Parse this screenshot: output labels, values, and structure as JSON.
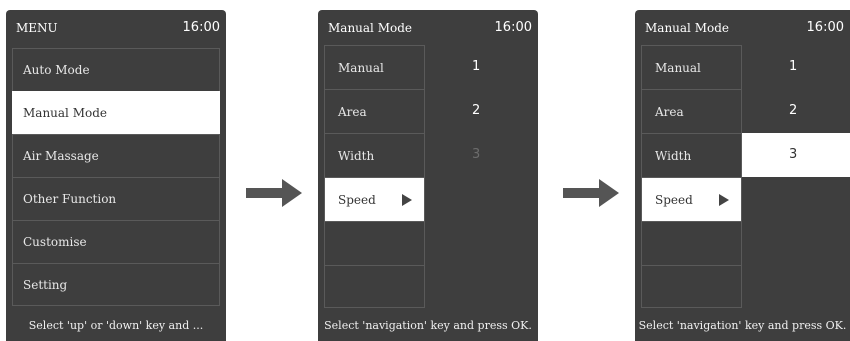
{
  "screen1": {
    "title": "MENU",
    "time": "16:00",
    "items": [
      {
        "label": "Auto Mode",
        "selected": false
      },
      {
        "label": "Manual Mode",
        "selected": true
      },
      {
        "label": "Air Massage",
        "selected": false
      },
      {
        "label": "Other Function",
        "selected": false
      },
      {
        "label": "Customise",
        "selected": false
      },
      {
        "label": "Setting",
        "selected": false
      }
    ],
    "footer": "Select 'up' or 'down' key and ..."
  },
  "screen2": {
    "title": "Manual Mode",
    "time": "16:00",
    "labels": [
      "Manual",
      "Area",
      "Width",
      "Speed"
    ],
    "values": [
      "1",
      "2",
      "3"
    ],
    "selected_label": "Speed",
    "footer": "Select 'navigation' key and press OK."
  },
  "screen3": {
    "title": "Manual Mode",
    "time": "16:00",
    "labels": [
      "Manual",
      "Area",
      "Width",
      "Speed"
    ],
    "values": [
      "1",
      "2",
      "3"
    ],
    "selected_label": "Speed",
    "selected_value": "3",
    "footer": "Select 'navigation' key and press OK."
  },
  "colors": {
    "screen_bg": "#3e3e3e",
    "highlight": "#ffffff",
    "arrow": "#555555",
    "dim_value": "#6c6c6c"
  },
  "icons": {
    "selection_marker": "play-triangle-icon",
    "flow_arrow": "right-arrow-icon"
  }
}
